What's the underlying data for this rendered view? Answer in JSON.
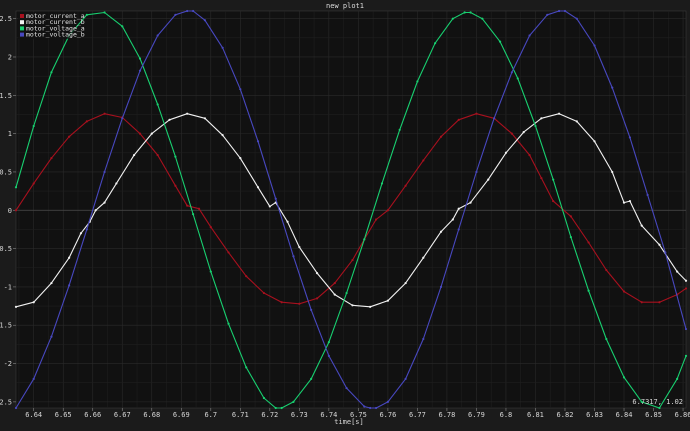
{
  "window": {
    "title": "new plot1"
  },
  "cursor_readout": "6.7317, 1.02",
  "chart_data": {
    "type": "line",
    "xlabel": "time[s]",
    "ylabel": "",
    "xlim": [
      6.634,
      6.861
    ],
    "ylim": [
      -2.58,
      2.6
    ],
    "grid": true,
    "legend_position": "top-left",
    "x_ticks": [
      "6.64",
      "6.65",
      "6.66",
      "6.67",
      "6.68",
      "6.69",
      "6.7",
      "6.71",
      "6.72",
      "6.73",
      "6.74",
      "6.75",
      "6.76",
      "6.77",
      "6.78",
      "6.79",
      "6.8",
      "6.81",
      "6.82",
      "6.83",
      "6.84",
      "6.85",
      "6.86"
    ],
    "y_ticks": [
      "2.5",
      "2",
      "1.5",
      "1",
      "0.5",
      "0",
      "-0.5",
      "-1",
      "-1.5",
      "-2",
      "-2.5"
    ],
    "series": [
      {
        "name": "motor_current_a",
        "color": "#a8101e",
        "x": [
          6.634,
          6.64,
          6.646,
          6.652,
          6.658,
          6.664,
          6.67,
          6.676,
          6.682,
          6.688,
          6.692,
          6.696,
          6.7,
          6.706,
          6.712,
          6.718,
          6.724,
          6.73,
          6.736,
          6.742,
          6.748,
          6.752,
          6.756,
          6.76,
          6.766,
          6.772,
          6.778,
          6.784,
          6.79,
          6.796,
          6.802,
          6.808,
          6.812,
          6.816,
          6.822,
          6.828,
          6.834,
          6.84,
          6.846,
          6.852,
          6.858,
          6.861
        ],
        "values": [
          0.0,
          0.35,
          0.68,
          0.96,
          1.16,
          1.26,
          1.21,
          1.0,
          0.72,
          0.32,
          0.06,
          0.02,
          -0.22,
          -0.55,
          -0.86,
          -1.08,
          -1.2,
          -1.22,
          -1.15,
          -0.95,
          -0.65,
          -0.38,
          -0.12,
          0.0,
          0.32,
          0.65,
          0.96,
          1.18,
          1.26,
          1.2,
          1.0,
          0.72,
          0.42,
          0.12,
          -0.08,
          -0.42,
          -0.78,
          -1.06,
          -1.2,
          -1.2,
          -1.1,
          -1.02
        ]
      },
      {
        "name": "motor_current_b",
        "color": "#f2f2f2",
        "x": [
          6.634,
          6.64,
          6.646,
          6.652,
          6.656,
          6.659,
          6.661,
          6.664,
          6.668,
          6.674,
          6.68,
          6.686,
          6.692,
          6.698,
          6.704,
          6.71,
          6.716,
          6.72,
          6.722,
          6.726,
          6.73,
          6.736,
          6.742,
          6.748,
          6.754,
          6.76,
          6.766,
          6.772,
          6.778,
          6.782,
          6.784,
          6.788,
          6.794,
          6.8,
          6.806,
          6.812,
          6.818,
          6.824,
          6.83,
          6.836,
          6.84,
          6.842,
          6.846,
          6.852,
          6.858,
          6.861
        ],
        "values": [
          -1.26,
          -1.2,
          -0.95,
          -0.62,
          -0.3,
          -0.15,
          0.0,
          0.1,
          0.35,
          0.72,
          1.0,
          1.18,
          1.26,
          1.2,
          0.98,
          0.68,
          0.3,
          0.05,
          0.1,
          -0.15,
          -0.48,
          -0.82,
          -1.1,
          -1.24,
          -1.26,
          -1.18,
          -0.95,
          -0.62,
          -0.28,
          -0.12,
          0.02,
          0.1,
          0.4,
          0.75,
          1.02,
          1.2,
          1.26,
          1.16,
          0.9,
          0.5,
          0.1,
          0.12,
          -0.2,
          -0.45,
          -0.8,
          -0.92
        ]
      },
      {
        "name": "motor_voltage_a",
        "color": "#18d070",
        "x": [
          6.634,
          6.64,
          6.646,
          6.652,
          6.658,
          6.664,
          6.67,
          6.676,
          6.682,
          6.688,
          6.694,
          6.7,
          6.706,
          6.712,
          6.718,
          6.722,
          6.724,
          6.728,
          6.734,
          6.74,
          6.746,
          6.752,
          6.758,
          6.764,
          6.77,
          6.776,
          6.782,
          6.786,
          6.788,
          6.792,
          6.798,
          6.804,
          6.81,
          6.816,
          6.822,
          6.828,
          6.834,
          6.84,
          6.846,
          6.852,
          6.858,
          6.861
        ],
        "values": [
          0.3,
          1.1,
          1.8,
          2.28,
          2.55,
          2.58,
          2.4,
          1.98,
          1.38,
          0.7,
          -0.05,
          -0.8,
          -1.48,
          -2.05,
          -2.45,
          -2.58,
          -2.58,
          -2.5,
          -2.2,
          -1.72,
          -1.08,
          -0.38,
          0.35,
          1.05,
          1.68,
          2.18,
          2.5,
          2.58,
          2.58,
          2.5,
          2.2,
          1.72,
          1.1,
          0.4,
          -0.35,
          -1.05,
          -1.68,
          -2.18,
          -2.5,
          -2.58,
          -2.2,
          -1.9
        ]
      },
      {
        "name": "motor_voltage_b",
        "color": "#4848c0",
        "x": [
          6.634,
          6.64,
          6.646,
          6.652,
          6.658,
          6.664,
          6.67,
          6.676,
          6.682,
          6.688,
          6.692,
          6.694,
          6.698,
          6.704,
          6.71,
          6.716,
          6.722,
          6.728,
          6.734,
          6.74,
          6.746,
          6.752,
          6.754,
          6.756,
          6.76,
          6.766,
          6.772,
          6.778,
          6.784,
          6.79,
          6.796,
          6.802,
          6.808,
          6.814,
          6.818,
          6.82,
          6.824,
          6.83,
          6.836,
          6.842,
          6.848,
          6.854,
          6.861
        ],
        "values": [
          -2.58,
          -2.2,
          -1.65,
          -0.98,
          -0.25,
          0.5,
          1.2,
          1.82,
          2.28,
          2.55,
          2.6,
          2.6,
          2.48,
          2.12,
          1.58,
          0.9,
          0.15,
          -0.6,
          -1.3,
          -1.9,
          -2.32,
          -2.56,
          -2.58,
          -2.58,
          -2.5,
          -2.2,
          -1.68,
          -1.0,
          -0.25,
          0.5,
          1.2,
          1.8,
          2.28,
          2.55,
          2.6,
          2.6,
          2.5,
          2.15,
          1.6,
          0.95,
          0.2,
          -0.55,
          -1.55
        ]
      }
    ]
  }
}
